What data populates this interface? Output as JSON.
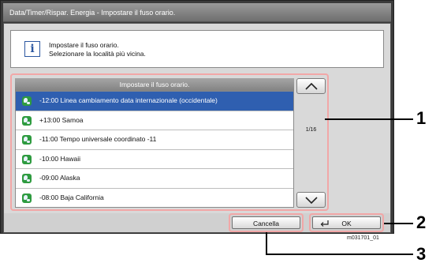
{
  "window": {
    "title": "Data/Timer/Rispar. Energia - Impostare il fuso orario."
  },
  "message": {
    "icon": "info-icon",
    "line1": "Impostare il fuso orario.",
    "line2": "Selezionare la località più vicina."
  },
  "list": {
    "header": "Impostare il fuso orario.",
    "items": [
      {
        "label": "-12:00 Linea cambiamento data internazionale (occidentale)",
        "selected": true
      },
      {
        "label": "+13:00 Samoa",
        "selected": false
      },
      {
        "label": "-11:00 Tempo universale coordinato -11",
        "selected": false
      },
      {
        "label": "-10:00 Hawaii",
        "selected": false
      },
      {
        "label": "-09:00 Alaska",
        "selected": false
      },
      {
        "label": "-08:00 Baja California",
        "selected": false
      }
    ],
    "page_indicator": "1/16"
  },
  "buttons": {
    "cancel_label": "Cancella",
    "ok_label": "OK"
  },
  "figure_code": "m031701_01",
  "callouts": [
    "1",
    "2",
    "3"
  ],
  "colors": {
    "selection": "#2f5fb0",
    "highlight_outline": "#f2a7a7"
  }
}
